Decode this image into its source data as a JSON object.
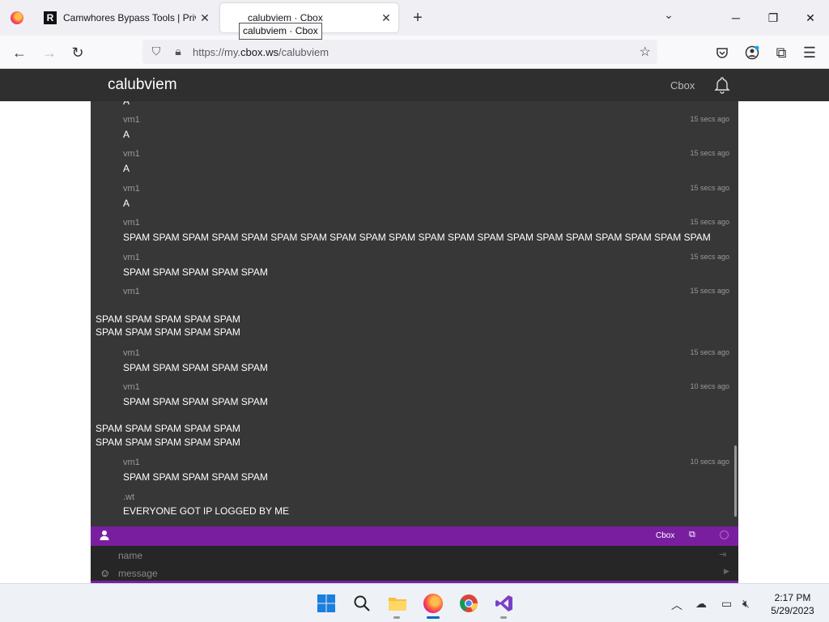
{
  "browser": {
    "tabs": [
      {
        "title": "Camwhores Bypass Tools | Priva",
        "favicon": "R",
        "active": false
      },
      {
        "title": "calubviem · Cbox",
        "active": true
      }
    ],
    "tooltip": "calubviem · Cbox",
    "url_prefix": "https://my.",
    "url_domain": "cbox.ws",
    "url_path": "/calubviem"
  },
  "site": {
    "title": "calubviem",
    "cbox_link": "Cbox"
  },
  "chat": {
    "partial_top": "A",
    "messages": [
      {
        "name": "vm1",
        "time": "15 secs ago",
        "text": "A"
      },
      {
        "name": "vm1",
        "time": "15 secs ago",
        "text": "A"
      },
      {
        "name": "vm1",
        "time": "15 secs ago",
        "text": "A"
      },
      {
        "name": "vm1",
        "time": "15 secs ago",
        "text": "SPAM SPAM SPAM SPAM SPAM SPAM SPAM SPAM SPAM SPAM SPAM SPAM SPAM SPAM SPAM SPAM SPAM SPAM SPAM SPAM"
      },
      {
        "name": "vm1",
        "time": "15 secs ago",
        "text": "SPAM SPAM SPAM SPAM SPAM"
      },
      {
        "name": "vm1",
        "time": "15 secs ago",
        "text": ""
      },
      {
        "name": "vm1",
        "time": "15 secs ago",
        "text": "SPAM SPAM SPAM SPAM SPAM"
      },
      {
        "name": "vm1",
        "time": "10 secs ago",
        "text": "SPAM SPAM SPAM SPAM SPAM"
      },
      {
        "name": "vm1",
        "time": "10 secs ago",
        "text": "SPAM SPAM SPAM SPAM SPAM"
      },
      {
        "name": ".wt",
        "time": "",
        "text": "EVERYONE GOT IP LOGGED BY ME"
      }
    ],
    "raw_blocks": [
      [
        "SPAM SPAM SPAM SPAM SPAM",
        "SPAM SPAM SPAM SPAM SPAM"
      ],
      [
        "SPAM SPAM SPAM SPAM SPAM",
        "SPAM SPAM SPAM SPAM SPAM"
      ]
    ]
  },
  "toolbar": {
    "cbox_label": "Cbox"
  },
  "form": {
    "name_placeholder": "name",
    "message_placeholder": "message"
  },
  "taskbar": {
    "time": "2:17 PM",
    "date": "5/29/2023"
  },
  "colors": {
    "chat_bg": "#373737",
    "header_bg": "#2f2f2f",
    "accent_purple": "#7a1ea0"
  }
}
